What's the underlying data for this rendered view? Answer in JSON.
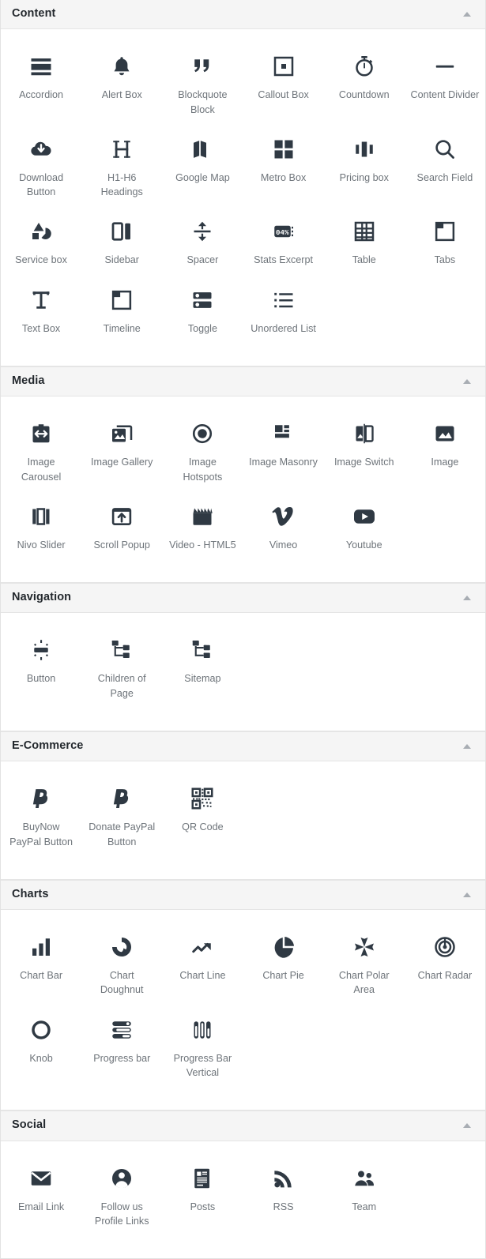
{
  "panel": {
    "collapse_icon": "caret-up-icon"
  },
  "sections": [
    {
      "title": "Content",
      "items": [
        {
          "label": "Accordion",
          "icon": "accordion-icon"
        },
        {
          "label": "Alert Box",
          "icon": "bell-icon"
        },
        {
          "label": "Blockquote Block",
          "icon": "quote-icon"
        },
        {
          "label": "Callout Box",
          "icon": "callout-box-icon"
        },
        {
          "label": "Countdown",
          "icon": "stopwatch-icon"
        },
        {
          "label": "Content Divider",
          "icon": "divider-icon"
        },
        {
          "label": "Download Button",
          "icon": "cloud-download-icon"
        },
        {
          "label": "H1-H6 Headings",
          "icon": "heading-h-icon"
        },
        {
          "label": "Google Map",
          "icon": "map-icon"
        },
        {
          "label": "Metro Box",
          "icon": "metro-grid-icon"
        },
        {
          "label": "Pricing box",
          "icon": "pricing-columns-icon"
        },
        {
          "label": "Search Field",
          "icon": "search-icon"
        },
        {
          "label": "Service box",
          "icon": "shapes-icon"
        },
        {
          "label": "Sidebar",
          "icon": "sidebar-icon"
        },
        {
          "label": "Spacer",
          "icon": "spacer-arrows-icon"
        },
        {
          "label": "Stats Excerpt",
          "icon": "stats-counter-icon"
        },
        {
          "label": "Table",
          "icon": "table-grid-icon"
        },
        {
          "label": "Tabs",
          "icon": "tabs-icon"
        },
        {
          "label": "Text Box",
          "icon": "text-t-icon"
        },
        {
          "label": "Timeline",
          "icon": "timeline-icon"
        },
        {
          "label": "Toggle",
          "icon": "toggle-rows-icon"
        },
        {
          "label": "Unordered List",
          "icon": "unordered-list-icon"
        }
      ]
    },
    {
      "title": "Media",
      "items": [
        {
          "label": "Image Carousel",
          "icon": "image-carousel-icon"
        },
        {
          "label": "Image Gallery",
          "icon": "image-gallery-icon"
        },
        {
          "label": "Image Hotspots",
          "icon": "hotspot-circle-icon"
        },
        {
          "label": "Image Masonry",
          "icon": "masonry-icon"
        },
        {
          "label": "Image Switch",
          "icon": "image-switch-icon"
        },
        {
          "label": "Image",
          "icon": "image-icon"
        },
        {
          "label": "Nivo Slider",
          "icon": "nivo-slider-icon"
        },
        {
          "label": "Scroll Popup",
          "icon": "scroll-popup-icon"
        },
        {
          "label": "Video - HTML5",
          "icon": "clapperboard-icon"
        },
        {
          "label": "Vimeo",
          "icon": "vimeo-icon"
        },
        {
          "label": "Youtube",
          "icon": "youtube-icon"
        }
      ]
    },
    {
      "title": "Navigation",
      "items": [
        {
          "label": "Button",
          "icon": "button-icon"
        },
        {
          "label": "Children of Page",
          "icon": "children-of-page-icon"
        },
        {
          "label": "Sitemap",
          "icon": "sitemap-icon"
        }
      ]
    },
    {
      "title": "E-Commerce",
      "items": [
        {
          "label": "BuyNow PayPal Button",
          "icon": "paypal-icon"
        },
        {
          "label": "Donate PayPal Button",
          "icon": "paypal-icon"
        },
        {
          "label": "QR Code",
          "icon": "qr-code-icon"
        }
      ]
    },
    {
      "title": "Charts",
      "items": [
        {
          "label": "Chart Bar",
          "icon": "chart-bar-icon"
        },
        {
          "label": "Chart Doughnut",
          "icon": "chart-doughnut-icon"
        },
        {
          "label": "Chart Line",
          "icon": "chart-line-icon"
        },
        {
          "label": "Chart Pie",
          "icon": "chart-pie-icon"
        },
        {
          "label": "Chart Polar Area",
          "icon": "chart-polar-area-icon"
        },
        {
          "label": "Chart Radar",
          "icon": "chart-radar-icon"
        },
        {
          "label": "Knob",
          "icon": "knob-icon"
        },
        {
          "label": "Progress bar",
          "icon": "progress-bar-icon"
        },
        {
          "label": "Progress Bar Vertical",
          "icon": "progress-bar-vertical-icon"
        }
      ]
    },
    {
      "title": "Social",
      "items": [
        {
          "label": "Email Link",
          "icon": "envelope-icon"
        },
        {
          "label": "Follow us Profile Links",
          "icon": "user-circle-icon"
        },
        {
          "label": "Posts",
          "icon": "posts-icon"
        },
        {
          "label": "RSS",
          "icon": "rss-icon"
        },
        {
          "label": "Team",
          "icon": "team-icon"
        }
      ]
    }
  ],
  "colors": {
    "icon": "#2f3943",
    "label": "#6e747a",
    "header_bg": "#f5f5f5",
    "header_text": "#23282d",
    "border": "#e5e5e5",
    "caret": "#a8adb3"
  }
}
